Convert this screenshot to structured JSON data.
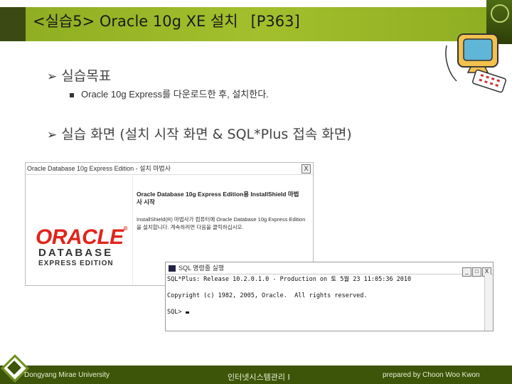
{
  "slide": {
    "title": "<실습5> Oracle 10g XE 설치",
    "page_ref": "[P363]"
  },
  "bullets": {
    "goal_heading": "실습목표",
    "goal_item": "Oracle 10g Express를 다운로드한 후, 설치한다.",
    "screen_heading": "실습 화면 (설치 시작 화면  & SQL*Plus 접속 화면)"
  },
  "installer_window": {
    "title": "Oracle Database 10g Express Edition - 설치 마법사",
    "close_label": "X",
    "heading": "Oracle Database 10g Express Edition용 InstallShield 마법사 시작",
    "body": "InstallShield(R) 마법사가 컴퓨터에 Oracle Database 10g Express Edition을 설치합니다. 계속하려면 다음을 클릭하십시오.",
    "logo_text": "ORACLE",
    "logo_sub": "DATABASE",
    "logo_edition": "EXPRESS EDITION"
  },
  "sqlplus_window": {
    "title": "SQL 명령줄 실행",
    "min_label": "_",
    "max_label": "□",
    "close_label": "X",
    "line1": "SQL*Plus: Release 10.2.0.1.0 - Production on 토 5월 23 11:05:36 2010",
    "line2": "Copyright (c) 1982, 2005, Oracle.  All rights reserved.",
    "prompt": "SQL> "
  },
  "footer": {
    "left": "Dongyang Mirae University",
    "center": "인터넷시스템관리 I",
    "right": "prepared by Choon Woo Kwon"
  },
  "colors": {
    "title_band": "#a3bf2c",
    "footer": "#3d5509",
    "oracle_red": "#e2231a"
  }
}
